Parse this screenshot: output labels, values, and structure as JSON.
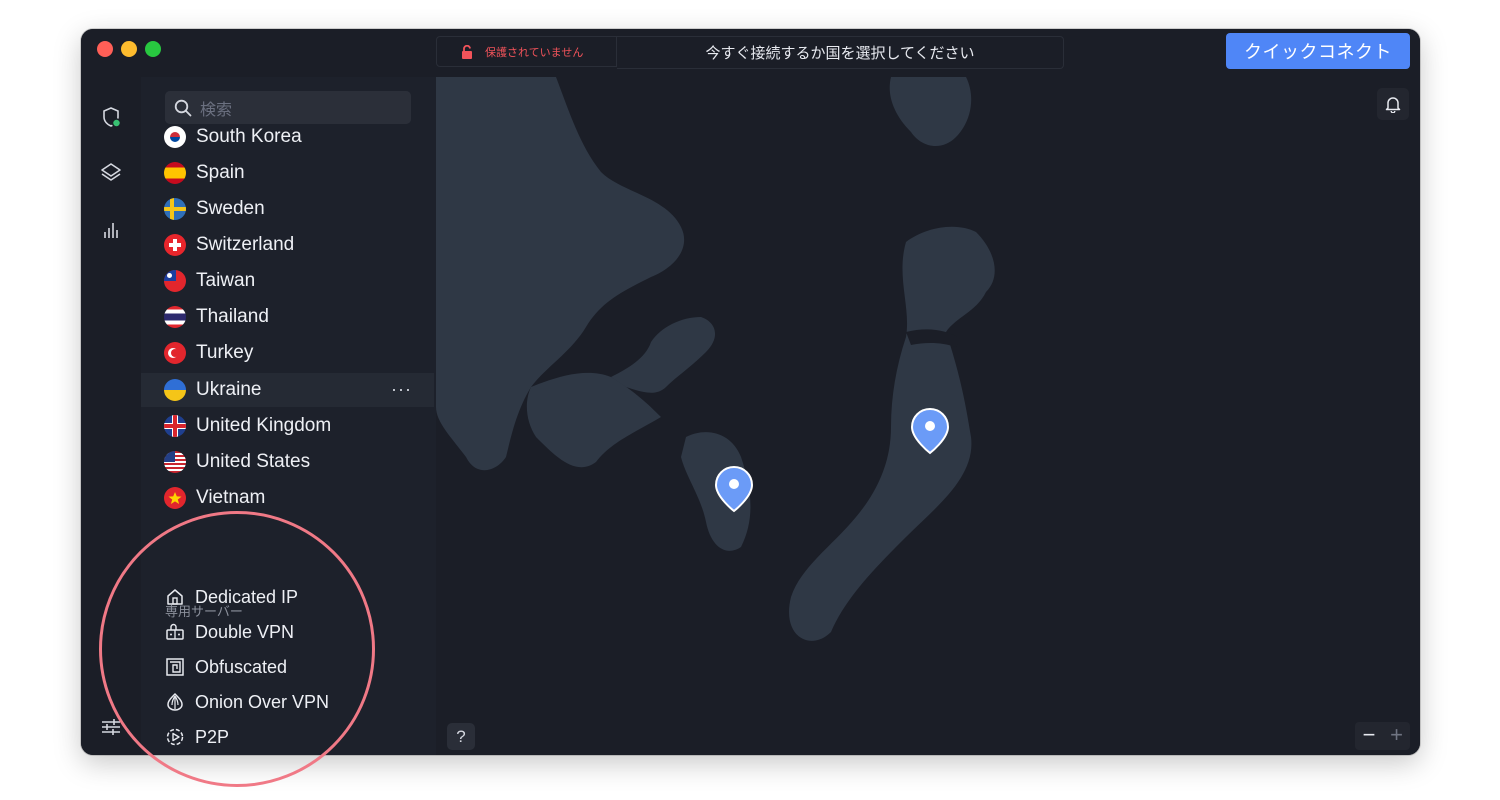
{
  "titlebar": {
    "status_text": "保護されていません",
    "prompt_text": "今すぐ接続するか国を選択してください",
    "quick_connect_label": "クイックコネクト"
  },
  "search": {
    "placeholder": "検索"
  },
  "countries": [
    {
      "name": "South Korea",
      "flag": "south-korea-flag"
    },
    {
      "name": "Spain",
      "flag": "spain-flag"
    },
    {
      "name": "Sweden",
      "flag": "sweden-flag"
    },
    {
      "name": "Switzerland",
      "flag": "switzerland-flag"
    },
    {
      "name": "Taiwan",
      "flag": "taiwan-flag"
    },
    {
      "name": "Thailand",
      "flag": "thailand-flag"
    },
    {
      "name": "Turkey",
      "flag": "turkey-flag"
    },
    {
      "name": "Ukraine",
      "flag": "ukraine-flag",
      "selected": true,
      "more_label": "···"
    },
    {
      "name": "United Kingdom",
      "flag": "uk-flag"
    },
    {
      "name": "United States",
      "flag": "us-flag"
    },
    {
      "name": "Vietnam",
      "flag": "vietnam-flag"
    }
  ],
  "specialty": {
    "title": "専用サーバー",
    "items": [
      {
        "label": "Dedicated IP",
        "icon": "house-icon"
      },
      {
        "label": "Double VPN",
        "icon": "double-lock-icon"
      },
      {
        "label": "Obfuscated",
        "icon": "maze-icon"
      },
      {
        "label": "Onion Over VPN",
        "icon": "onion-icon"
      },
      {
        "label": "P2P",
        "icon": "p2p-icon"
      }
    ]
  },
  "map": {
    "help_label": "?",
    "zoom_out_label": "−",
    "zoom_in_label": "+"
  },
  "colors": {
    "accent": "#4f86f7",
    "danger": "#f2535a",
    "highlight_ring": "#f07986",
    "connected_dot": "#38c172"
  }
}
